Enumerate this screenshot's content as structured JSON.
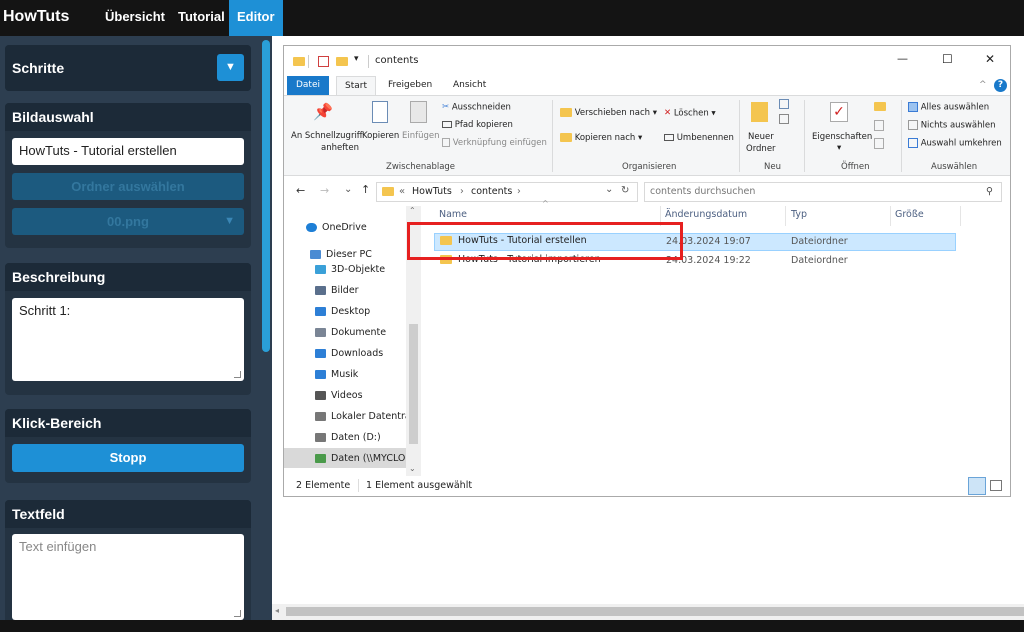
{
  "nav": {
    "brand": "HowTuts",
    "links": [
      {
        "label": "Übersicht"
      },
      {
        "label": "Tutorial"
      },
      {
        "label": "Editor",
        "active": true
      }
    ]
  },
  "sidebar": {
    "steps": {
      "title": "Schritte",
      "dropdown_icon": "▼"
    },
    "image_select": {
      "title": "Bildauswahl",
      "folder_value": "HowTuts - Tutorial erstellen",
      "select_folder_button": "Ordner auswählen",
      "image_select_value": "00.png",
      "image_select_icon": "▼"
    },
    "description": {
      "title": "Beschreibung",
      "value": "Schritt 1:"
    },
    "click_area": {
      "title": "Klick-Bereich",
      "button": "Stopp"
    },
    "textfield": {
      "title": "Textfeld",
      "placeholder": "Text einfügen"
    }
  },
  "explorer": {
    "window_title": "contents",
    "quick_access_dropdown": "▾",
    "window_controls": {
      "minimize": "—",
      "maximize": "☐",
      "close": "✕"
    },
    "tabs": [
      "Datei",
      "Start",
      "Freigeben",
      "Ansicht"
    ],
    "active_tab": "Start",
    "ribbon_collapse": "^",
    "help": "?",
    "ribbon": {
      "clipboard": {
        "pin_label_1": "An Schnellzugriff",
        "pin_label_2": "anheften",
        "copy_label": "Kopieren",
        "paste_label": "Einfügen",
        "cut": "Ausschneiden",
        "copy_path": "Pfad kopieren",
        "paste_shortcut": "Verknüpfung einfügen",
        "group": "Zwischenablage"
      },
      "organize": {
        "move_to": "Verschieben nach",
        "copy_to": "Kopieren nach",
        "delete": "Löschen",
        "rename": "Umbenennen",
        "group": "Organisieren"
      },
      "new": {
        "new_folder_1": "Neuer",
        "new_folder_2": "Ordner",
        "group": "Neu"
      },
      "open": {
        "properties": "Eigenschaften",
        "group": "Öffnen"
      },
      "select": {
        "select_all": "Alles auswählen",
        "select_none": "Nichts auswählen",
        "invert_selection": "Auswahl umkehren",
        "group": "Auswählen"
      }
    },
    "address": {
      "prefix": "«",
      "crumbs": [
        "HowTuts",
        "contents"
      ],
      "separator": "›",
      "dropdown": "⌄",
      "refresh": "↻"
    },
    "search_placeholder": "contents durchsuchen",
    "nav_items": [
      {
        "label": "OneDrive",
        "icon": "cloud-icon"
      },
      {
        "label": "Dieser PC",
        "icon": "pc-icon"
      },
      {
        "label": "3D-Objekte",
        "icon": "cube-icon"
      },
      {
        "label": "Bilder",
        "icon": "pictures-icon"
      },
      {
        "label": "Desktop",
        "icon": "desktop-icon"
      },
      {
        "label": "Dokumente",
        "icon": "documents-icon"
      },
      {
        "label": "Downloads",
        "icon": "download-icon"
      },
      {
        "label": "Musik",
        "icon": "music-icon"
      },
      {
        "label": "Videos",
        "icon": "video-icon"
      },
      {
        "label": "Lokaler Datenträ",
        "icon": "drive-icon"
      },
      {
        "label": "Daten (D:)",
        "icon": "drive-icon"
      },
      {
        "label": "Daten (\\\\MYCLOU",
        "icon": "network-drive-icon"
      }
    ],
    "columns": [
      "Name",
      "Änderungsdatum",
      "Typ",
      "Größe"
    ],
    "rows": [
      {
        "name": "HowTuts - Tutorial erstellen",
        "date": "24.03.2024 19:07",
        "type": "Dateiordner",
        "size": "",
        "selected": true
      },
      {
        "name": "HowTuts - Tutorial importieren",
        "date": "24.03.2024 19:22",
        "type": "Dateiordner",
        "size": "",
        "selected": false
      }
    ],
    "status": {
      "count": "2 Elemente",
      "selected": "1 Element ausgewählt"
    }
  },
  "colors": {
    "accent": "#1e90d6",
    "panel": "#2d3e50",
    "highlight_box": "#e62020",
    "selection": "#cce8ff"
  }
}
